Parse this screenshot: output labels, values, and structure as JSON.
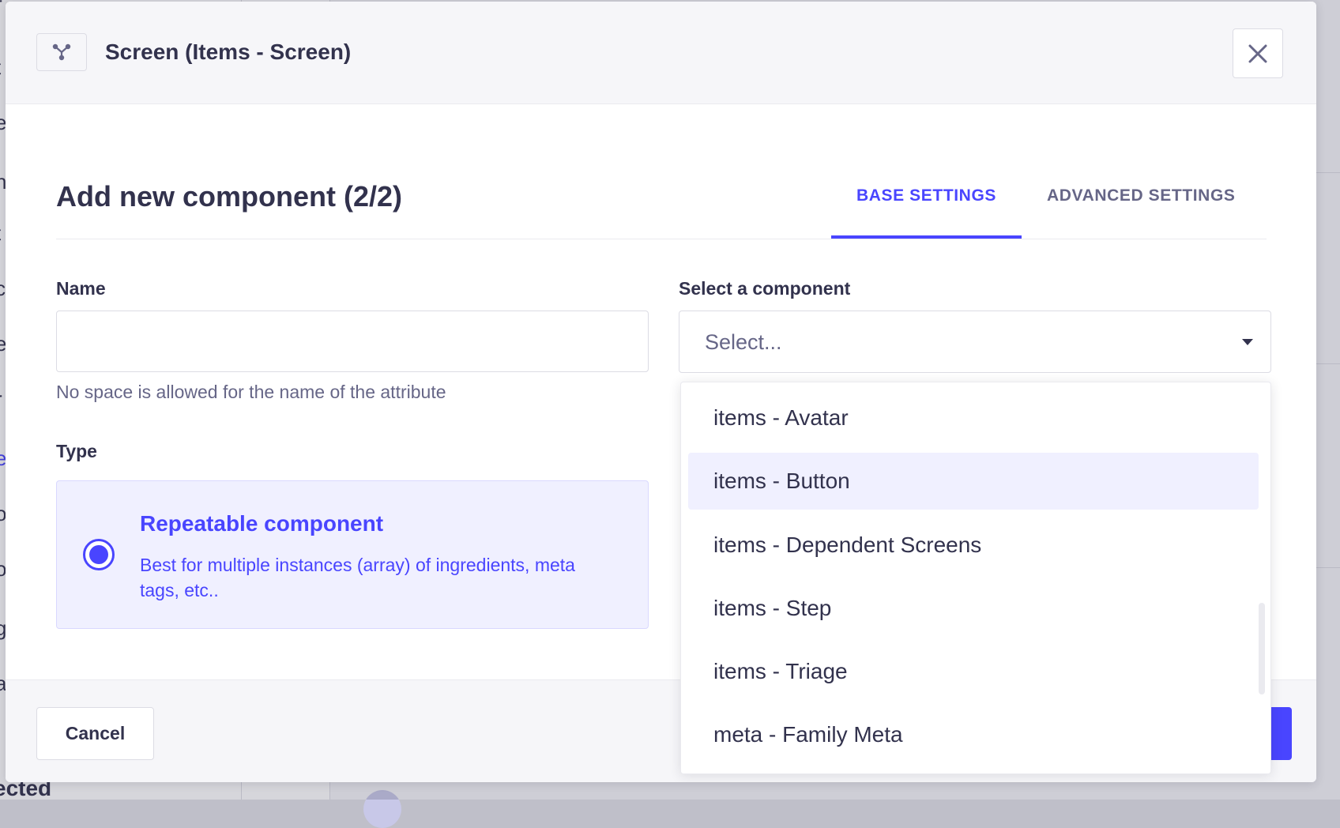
{
  "background": {
    "letters": [
      "r",
      "t",
      "e",
      "n",
      "t",
      "c",
      "e",
      "r",
      "e",
      "o",
      "o",
      "g",
      "a",
      "i"
    ],
    "bottom_text": "ected"
  },
  "header": {
    "title": "Screen (Items - Screen)",
    "icon": "component-connector-icon"
  },
  "form": {
    "title": "Add new component (2/2)",
    "tabs": [
      {
        "label": "BASE SETTINGS",
        "active": true
      },
      {
        "label": "ADVANCED SETTINGS",
        "active": false
      }
    ],
    "name": {
      "label": "Name",
      "value": "",
      "hint": "No space is allowed for the name of the attribute"
    },
    "type": {
      "label": "Type",
      "option_title": "Repeatable component",
      "option_desc": "Best for multiple instances (array) of ingredients, meta tags, etc.."
    },
    "component_select": {
      "label": "Select a component",
      "placeholder": "Select...",
      "options": [
        {
          "label": "items - Avatar"
        },
        {
          "label": "items - Button"
        },
        {
          "label": "items - Dependent Screens"
        },
        {
          "label": "items - Step"
        },
        {
          "label": "items - Triage"
        },
        {
          "label": "meta - Family Meta"
        }
      ],
      "highlighted_option": "items - Button"
    }
  },
  "footer": {
    "cancel_label": "Cancel"
  },
  "colors": {
    "primary": "#4945ff",
    "text": "#32324d",
    "muted": "#666687",
    "highlight_bg": "#f0f0ff"
  }
}
